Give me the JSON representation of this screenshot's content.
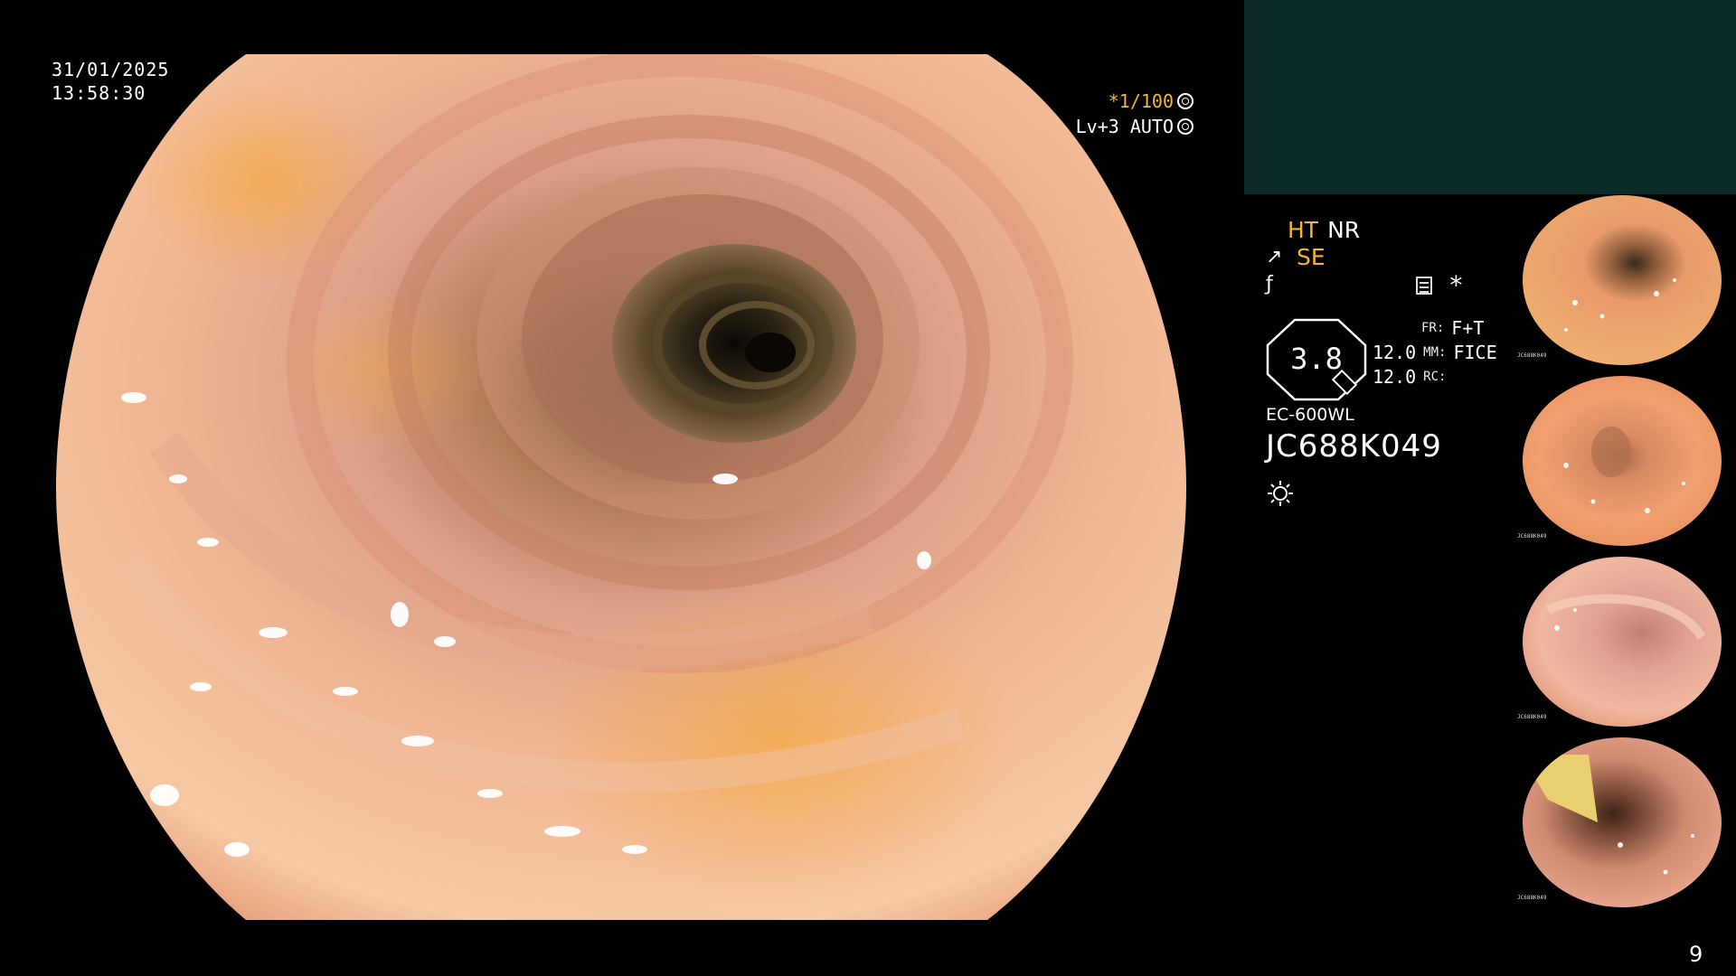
{
  "overlay": {
    "date": "31/01/2025",
    "time": "13:58:30",
    "shutter": "*1/100",
    "level": "Lv+3 AUTO"
  },
  "panel": {
    "flag_ht": "HT",
    "flag_nr": "NR",
    "flag_se": "SE",
    "zoom_value": "3.8",
    "param_1_value": "12.0",
    "param_1_label": "FR:",
    "param_1_mode": "F+T",
    "param_2_value": "12.0",
    "param_2_label": "MM:",
    "param_2_mode": "FICE",
    "param_3_label": "RC:",
    "scope_model": "EC-600WL",
    "scope_serial": "JC688K049"
  },
  "thumbnails": [
    {
      "caption": "JC688K049"
    },
    {
      "caption": "JC688K049"
    },
    {
      "caption": "JC688K049"
    },
    {
      "caption": "JC688K049"
    }
  ],
  "page_number": "9",
  "colors": {
    "accent": "#f2b53a",
    "panel_bg": "#0b2a28",
    "mucosa_base": "#e89a6a"
  }
}
